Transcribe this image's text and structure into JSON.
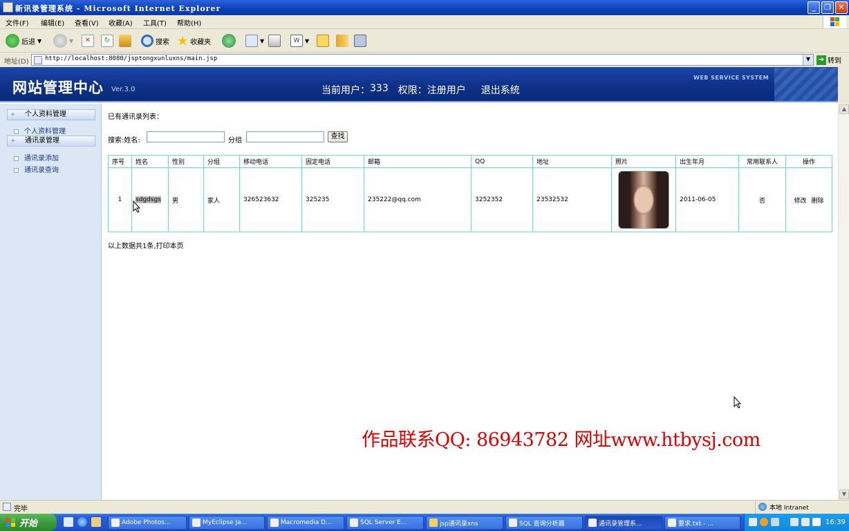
{
  "window": {
    "title": "新讯录管理系统 - Microsoft Internet Explorer",
    "min_label": "_",
    "max_label": "❐",
    "close_label": "✕"
  },
  "menu": [
    "文件(F)",
    "编辑(E)",
    "查看(V)",
    "收藏(A)",
    "工具(T)",
    "帮助(H)"
  ],
  "toolbar": {
    "back_label": "后退",
    "search_label": "搜索",
    "favorites_label": "收藏夹"
  },
  "address": {
    "label": "地址(D)",
    "url": "http://localhost:8080/jsptongxunluxns/main.jsp",
    "go_label": "转到"
  },
  "banner": {
    "logo": "网站管理中心",
    "version": "Ver.3.0",
    "current_user_label": "当前用户：",
    "current_user": "333",
    "permission_label": "权限：",
    "permission": "注册用户",
    "logout": "退出系统",
    "web_service": "WEB SERVICE SYSTEM"
  },
  "sidebar": {
    "groups": [
      {
        "label": "个人资料管理",
        "items": [
          "个人资料管理"
        ]
      },
      {
        "label": "通讯录管理",
        "items": [
          "通讯录添加",
          "通讯录查询"
        ]
      }
    ]
  },
  "main": {
    "list_title": "已有通讯录列表：",
    "search_label": "搜索:姓名:",
    "group_label": "分组",
    "name_value": "",
    "group_value": "",
    "find_button": "查找",
    "columns": [
      "序号",
      "姓名",
      "性别",
      "分组",
      "移动电话",
      "固定电话",
      "邮箱",
      "QQ",
      "地址",
      "照片",
      "出生年月",
      "常用联系人",
      "操作"
    ],
    "rows": [
      {
        "no": "1",
        "name": "sdgdsgs",
        "gender": "男",
        "group": "家人",
        "mobile": "326523632",
        "phone": "325235",
        "email": "235222@qq.com",
        "qq": "3252352",
        "address": "23532532",
        "birth": "2011-06-05",
        "frequent": "否",
        "edit": "修改",
        "delete": "删除"
      }
    ],
    "footer_text": "以上数据共1条,",
    "print_link": "打印本页"
  },
  "watermark": "作品联系QQ: 86943782 网址www.htbysj.com",
  "status": {
    "left": "完毕",
    "zone": "本地 Intranet"
  },
  "taskbar": {
    "start": "开始",
    "tasks": [
      "Adobe Photos...",
      "MyEclipse Ja...",
      "Macromedia D...",
      "SQL Server E...",
      "jsp通讯录xns",
      "SQL 查询分析器",
      "通讯录管理系...",
      "要求.txt - ..."
    ],
    "active_index": 6,
    "clock": "16:39"
  }
}
